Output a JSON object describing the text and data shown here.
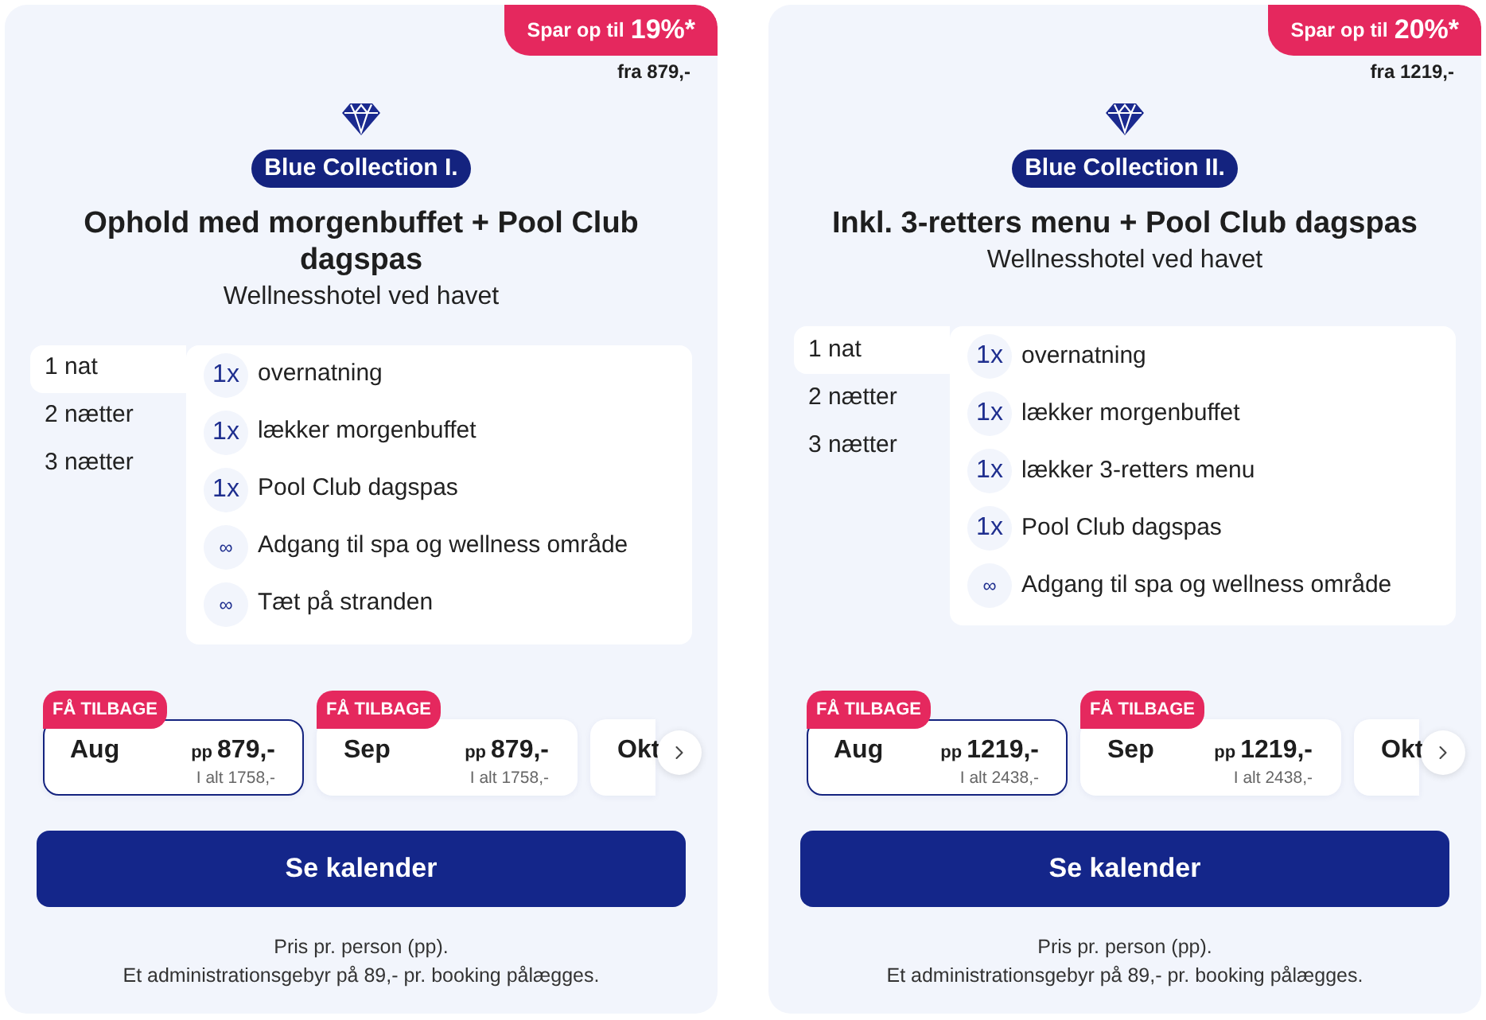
{
  "cards": [
    {
      "discount_badge": {
        "prefix": "Spar op til",
        "value": "19%*"
      },
      "from_price": "fra 879,-",
      "collection": "Blue Collection I.",
      "title": "Ophold med morgenbuffet + Pool Club dagspas",
      "subtitle": "Wellnesshotel ved havet",
      "stay_tabs": [
        {
          "label": "1 nat",
          "selected": true
        },
        {
          "label": "2 nætter",
          "selected": false
        },
        {
          "label": "3 nætter",
          "selected": false
        }
      ],
      "inclusions": [
        {
          "kind": "count",
          "badge": "1x",
          "text": "overnatning"
        },
        {
          "kind": "count",
          "badge": "1x",
          "text": "lækker morgenbuffet"
        },
        {
          "kind": "count",
          "badge": "1x",
          "text": "Pool Club dagspas"
        },
        {
          "kind": "unlimited",
          "badge": "∞",
          "text": "Adgang til spa og wellness område"
        },
        {
          "kind": "unlimited",
          "badge": "∞",
          "text": "Tæt på stranden"
        }
      ],
      "months": [
        {
          "month": "Aug",
          "tag": "FÅ TILBAGE",
          "pp_label": "pp",
          "price": "879,-",
          "total": "I alt 1758,-",
          "selected": true
        },
        {
          "month": "Sep",
          "tag": "FÅ TILBAGE",
          "pp_label": "pp",
          "price": "879,-",
          "total": "I alt 1758,-",
          "selected": false
        },
        {
          "month": "Okt",
          "selected": false
        }
      ],
      "calendar_button": "Se kalender",
      "notes": [
        "Pris pr. person (pp).",
        "Et administrationsgebyr på 89,- pr. booking pålægges."
      ]
    },
    {
      "discount_badge": {
        "prefix": "Spar op til",
        "value": "20%*"
      },
      "from_price": "fra 1219,-",
      "collection": "Blue Collection II.",
      "title": "Inkl. 3-retters menu + Pool Club dagspas",
      "subtitle": "Wellnesshotel ved havet",
      "stay_tabs": [
        {
          "label": "1 nat",
          "selected": true
        },
        {
          "label": "2 nætter",
          "selected": false
        },
        {
          "label": "3 nætter",
          "selected": false
        }
      ],
      "inclusions": [
        {
          "kind": "count",
          "badge": "1x",
          "text": "overnatning"
        },
        {
          "kind": "count",
          "badge": "1x",
          "text": "lækker morgenbuffet"
        },
        {
          "kind": "count",
          "badge": "1x",
          "text": "lækker 3-retters menu"
        },
        {
          "kind": "count",
          "badge": "1x",
          "text": "Pool Club dagspas"
        },
        {
          "kind": "unlimited",
          "badge": "∞",
          "text": "Adgang til spa og wellness område"
        }
      ],
      "months": [
        {
          "month": "Aug",
          "tag": "FÅ TILBAGE",
          "pp_label": "pp",
          "price": "1219,-",
          "total": "I alt 2438,-",
          "selected": true
        },
        {
          "month": "Sep",
          "tag": "FÅ TILBAGE",
          "pp_label": "pp",
          "price": "1219,-",
          "total": "I alt 2438,-",
          "selected": false
        },
        {
          "month": "Okt",
          "selected": false
        }
      ],
      "calendar_button": "Se kalender",
      "notes": [
        "Pris pr. person (pp).",
        "Et administrationsgebyr på 89,- pr. booking pålægges."
      ]
    }
  ]
}
